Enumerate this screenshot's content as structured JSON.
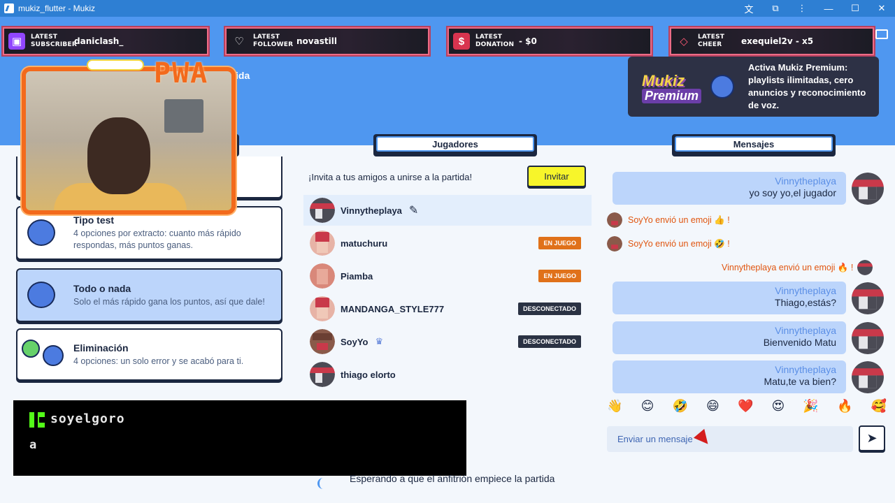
{
  "window": {
    "title": "mukiz_flutter - Mukiz",
    "controls": [
      "translate-icon",
      "extensions-icon",
      "more-icon",
      "minimize",
      "maximize",
      "close"
    ]
  },
  "alerts": [
    {
      "kind_line1": "LATEST",
      "kind_line2": "SUBSCRIBER",
      "value": "daniclash_",
      "icon": "twitch-icon"
    },
    {
      "kind_line1": "LATEST",
      "kind_line2": "FOLLOWER",
      "value": "novastill",
      "icon": "heart-icon"
    },
    {
      "kind_line1": "LATEST",
      "kind_line2": "DONATION",
      "value": "- $0",
      "icon": "dollar-icon"
    },
    {
      "kind_line1": "LATEST",
      "kind_line2": "CHEER",
      "value": "exequiel2v - x5",
      "icon": "diamond-icon"
    }
  ],
  "premium": {
    "logo_line1": "Mukiz",
    "logo_line2": "Premium",
    "text": "Activa Mukiz Premium: playlists ilimitadas, cero anuncios y reconocimiento de voz."
  },
  "webcam": {
    "overlay_text": "PWA",
    "partial_heading": "ida"
  },
  "modes": [
    {
      "title": "Tipo test",
      "desc": "4 opciones por extracto: cuanto más rápido respondas, más puntos ganas.",
      "selected": false
    },
    {
      "title": "Todo o nada",
      "desc": "Solo el más rápido gana los puntos, así que dale!",
      "selected": true
    },
    {
      "title": "Eliminación",
      "desc": "4 opciones: un solo error y se acabó para ti.",
      "selected": false
    }
  ],
  "players_section": {
    "tab_label": "Jugadores",
    "invite_text": "¡Invita a tus amigos a unirse a la partida!",
    "invite_button": "Invitar",
    "players": [
      {
        "name": "Vinnytheplaya",
        "status": "",
        "me": true
      },
      {
        "name": "matuchuru",
        "status": "EN JUEGO",
        "me": false
      },
      {
        "name": "Piamba",
        "status": "EN JUEGO",
        "me": false
      },
      {
        "name": "MANDANGA_STYLE777",
        "status": "DESCONECTADO",
        "me": false
      },
      {
        "name": "SoyYo",
        "status": "DESCONECTADO",
        "me": false,
        "host": true
      },
      {
        "name": "thiago elorto",
        "status": "",
        "me": false
      }
    ],
    "waiting_text": "Esperando a que el anfitrión empiece la partida"
  },
  "kick_chat": {
    "username": "soyelgoro",
    "message": "a"
  },
  "messages_section": {
    "tab_label": "Mensajes",
    "items": [
      {
        "type": "bubble",
        "user": "Vinnytheplaya",
        "text": "yo soy yo,el jugador"
      },
      {
        "type": "system",
        "text": "SoyYo envió un emoji 👍 !"
      },
      {
        "type": "system",
        "text": "SoyYo envió un emoji 🤣 !"
      },
      {
        "type": "system_right",
        "text": "Vinnytheplaya envió un emoji 🔥 !"
      },
      {
        "type": "bubble",
        "user": "Vinnytheplaya",
        "text": "Thiago,estás?"
      },
      {
        "type": "bubble",
        "user": "Vinnytheplaya",
        "text": "Bienvenido Matu"
      },
      {
        "type": "bubble",
        "user": "Vinnytheplaya",
        "text": "Matu,te va bien?"
      }
    ],
    "emojis": [
      "👋",
      "😊",
      "🤣",
      "😄",
      "❤️",
      "😍",
      "🎉",
      "🔥",
      "🥰"
    ],
    "input_placeholder": "Enviar un mensaje"
  }
}
